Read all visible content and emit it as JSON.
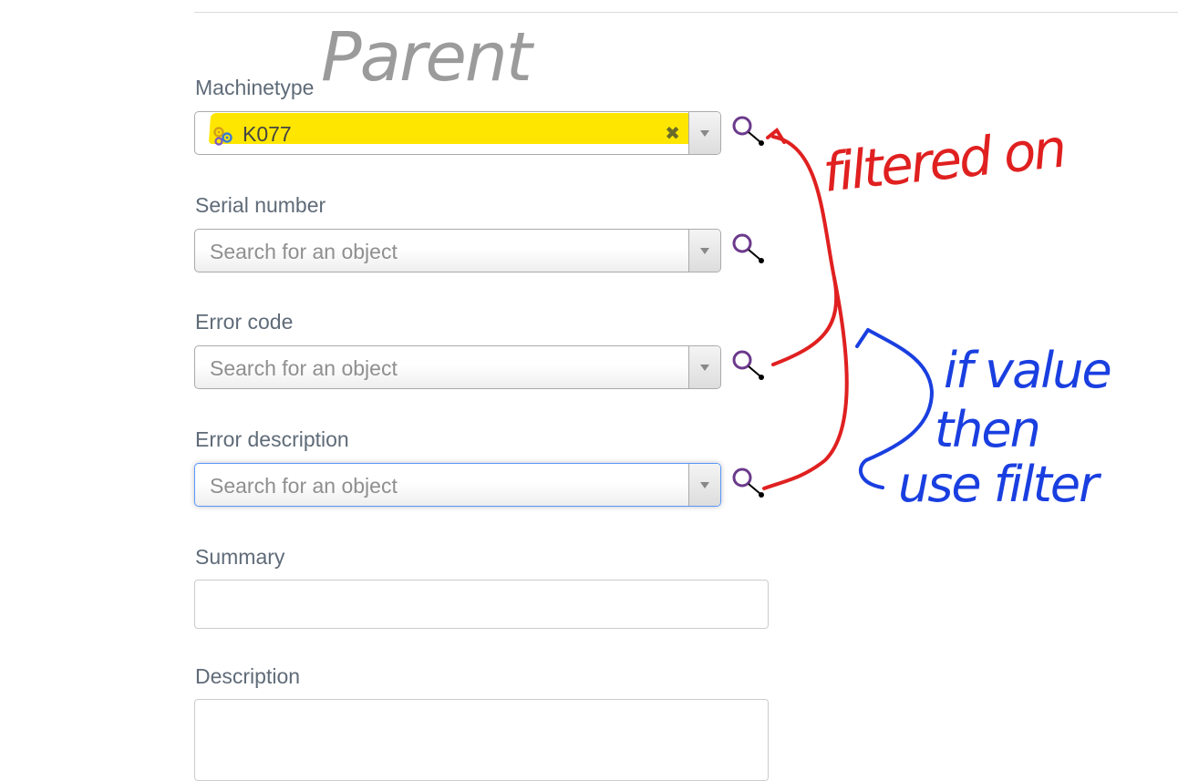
{
  "annotations": {
    "parent": "Parent",
    "filtered_on": "filtered on",
    "if_value_then_use_filter": "if value then use filter"
  },
  "fields": {
    "machinetype": {
      "label": "Machinetype",
      "value": "K077",
      "icon": "object-type-icon"
    },
    "serial_number": {
      "label": "Serial number",
      "placeholder": "Search for an object"
    },
    "error_code": {
      "label": "Error code",
      "placeholder": "Search for an object"
    },
    "error_description": {
      "label": "Error description",
      "placeholder": "Search for an object"
    },
    "summary": {
      "label": "Summary",
      "value": ""
    },
    "description": {
      "label": "Description",
      "value": ""
    }
  },
  "icons": {
    "lookup": "search-lookup-icon",
    "clear": "clear-x-icon",
    "dropdown": "chevron-down-icon"
  },
  "colors": {
    "highlight": "#ffe600",
    "annotation_red": "#e02020",
    "annotation_blue": "#1a3fe0",
    "annotation_gray": "#8a8a8a",
    "lookup_icon": "#6b3a8c"
  }
}
